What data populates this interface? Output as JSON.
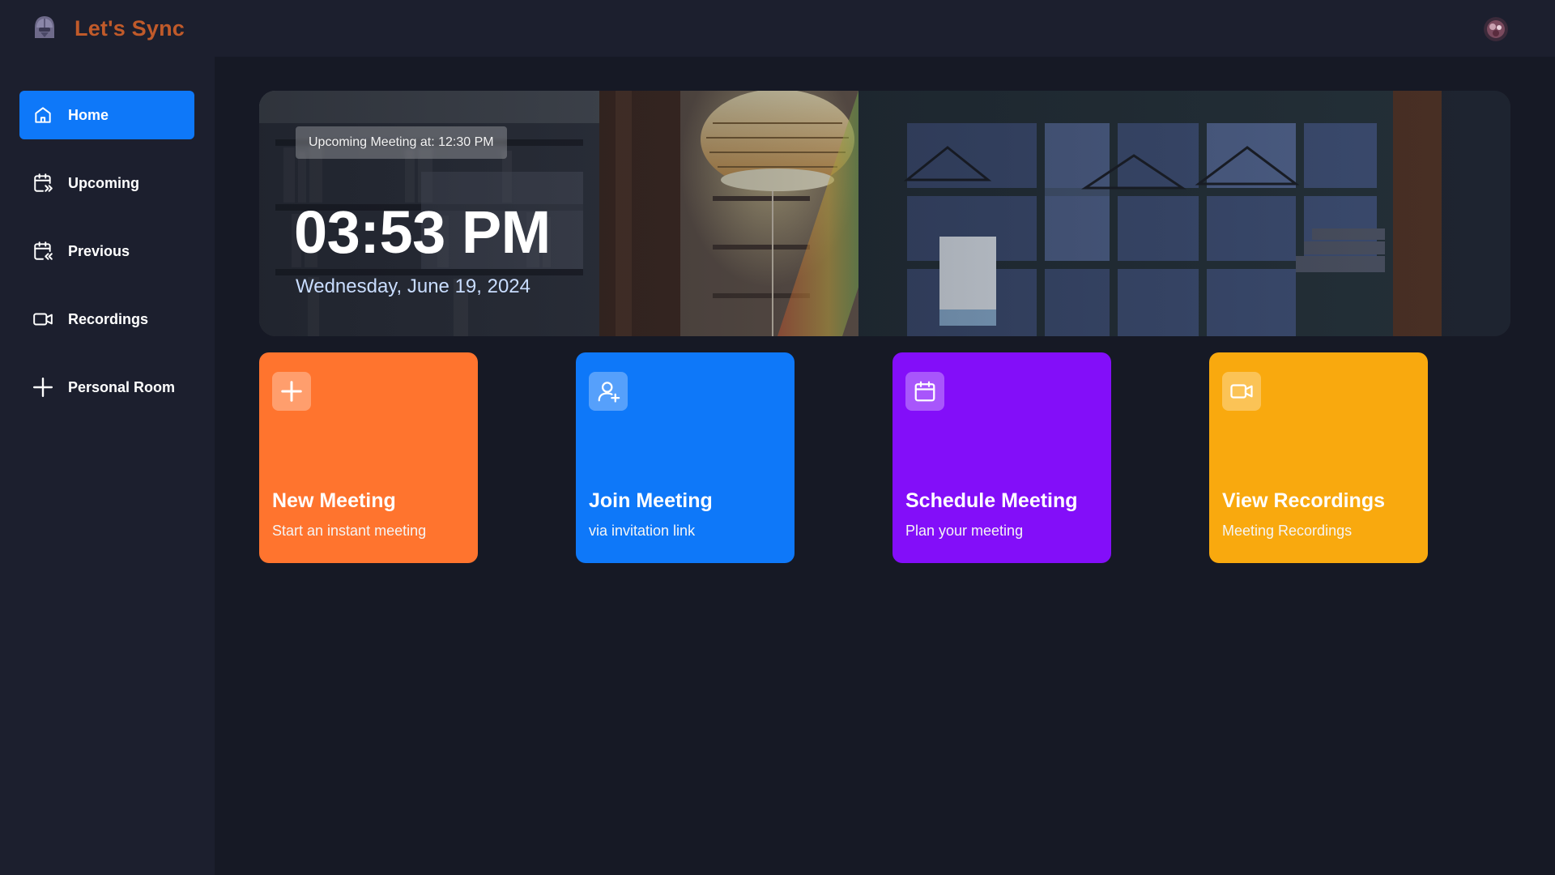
{
  "app": {
    "brand": "Let's Sync",
    "logo_icon": "helmet-logo-icon",
    "brand_color": "#c05a2a"
  },
  "header": {
    "avatar_icon": "user-avatar-icon"
  },
  "sidebar": {
    "items": [
      {
        "label": "Home",
        "icon": "home-icon",
        "active": true
      },
      {
        "label": "Upcoming",
        "icon": "calendar-upcoming-icon",
        "active": false
      },
      {
        "label": "Previous",
        "icon": "calendar-previous-icon",
        "active": false
      },
      {
        "label": "Recordings",
        "icon": "video-icon",
        "active": false
      },
      {
        "label": "Personal Room",
        "icon": "plus-icon",
        "active": false
      }
    ],
    "active_color": "#0e78f9"
  },
  "hero": {
    "badge": "Upcoming Meeting at: 12:30 PM",
    "time": "03:53 PM",
    "date": "Wednesday, June 19, 2024"
  },
  "cards": [
    {
      "title": "New Meeting",
      "subtitle": "Start an instant meeting",
      "icon": "plus-icon",
      "color": "#ff742e"
    },
    {
      "title": "Join Meeting",
      "subtitle": "via invitation link",
      "icon": "user-add-icon",
      "color": "#0e78f9"
    },
    {
      "title": "Schedule Meeting",
      "subtitle": "Plan your meeting",
      "icon": "calendar-icon",
      "color": "#830ef9"
    },
    {
      "title": "View Recordings",
      "subtitle": "Meeting Recordings",
      "icon": "video-icon",
      "color": "#f9a90e"
    }
  ]
}
